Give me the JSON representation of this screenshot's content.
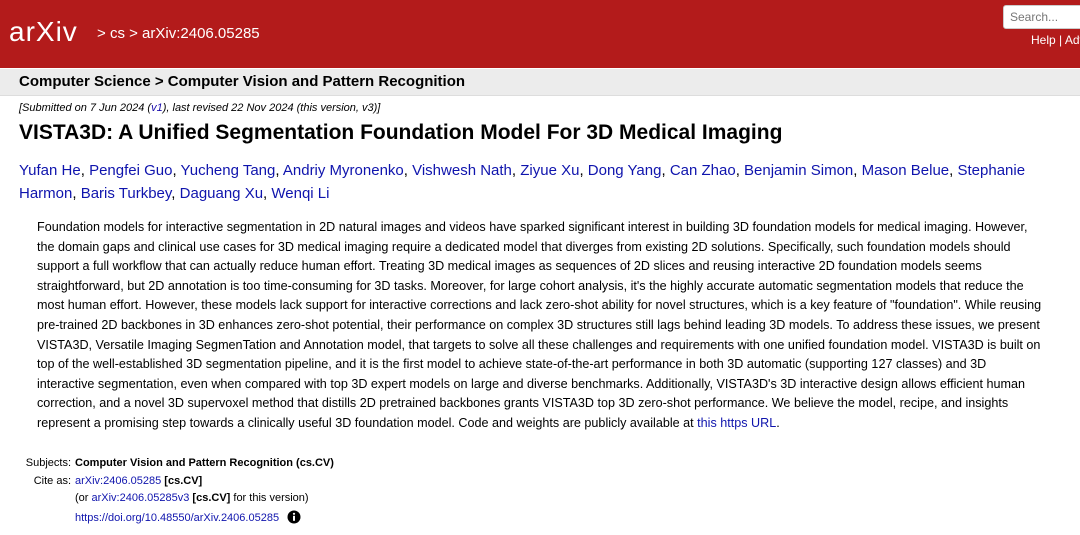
{
  "header": {
    "logo_text": "arXiv",
    "breadcrumb_sep": ">",
    "breadcrumb_cs": "cs",
    "breadcrumb_id": "arXiv:2406.05285",
    "search_placeholder": "Search...",
    "help_link": "Help",
    "link_sep": "|",
    "advanced_link": "Adv",
    "colors": {
      "bar": "#b31b1b",
      "link": "#0f14ad"
    }
  },
  "category": "Computer Science > Computer Vision and Pattern Recognition",
  "submission": {
    "submitted_prefix": "[Submitted on 7 Jun 2024 (",
    "v1_link": "v1",
    "submitted_suffix": "), last revised 22 Nov 2024 (this version, v3)]"
  },
  "title": "VISTA3D: A Unified Segmentation Foundation Model For 3D Medical Imaging",
  "authors": [
    "Yufan He",
    "Pengfei Guo",
    "Yucheng Tang",
    "Andriy Myronenko",
    "Vishwesh Nath",
    "Ziyue Xu",
    "Dong Yang",
    "Can Zhao",
    "Benjamin Simon",
    "Mason Belue",
    "Stephanie Harmon",
    "Baris Turkbey",
    "Daguang Xu",
    "Wenqi Li"
  ],
  "abstract": {
    "text": "Foundation models for interactive segmentation in 2D natural images and videos have sparked significant interest in building 3D foundation models for medical imaging. However, the domain gaps and clinical use cases for 3D medical imaging require a dedicated model that diverges from existing 2D solutions. Specifically, such foundation models should support a full workflow that can actually reduce human effort. Treating 3D medical images as sequences of 2D slices and reusing interactive 2D foundation models seems straightforward, but 2D annotation is too time-consuming for 3D tasks. Moreover, for large cohort analysis, it's the highly accurate automatic segmentation models that reduce the most human effort. However, these models lack support for interactive corrections and lack zero-shot ability for novel structures, which is a key feature of \"foundation\". While reusing pre-trained 2D backbones in 3D enhances zero-shot potential, their performance on complex 3D structures still lags behind leading 3D models. To address these issues, we present VISTA3D, Versatile Imaging SegmenTation and Annotation model, that targets to solve all these challenges and requirements with one unified foundation model. VISTA3D is built on top of the well-established 3D segmentation pipeline, and it is the first model to achieve state-of-the-art performance in both 3D automatic (supporting 127 classes) and 3D interactive segmentation, even when compared with top 3D expert models on large and diverse benchmarks. Additionally, VISTA3D's 3D interactive design allows efficient human correction, and a novel 3D supervoxel method that distills 2D pretrained backbones grants VISTA3D top 3D zero-shot performance. We believe the model, recipe, and insights represent a promising step towards a clinically useful 3D foundation model. Code and weights are publicly available at ",
    "link_text": "this https URL",
    "end": "."
  },
  "metadata": {
    "subjects_label": "Subjects:",
    "subjects_value": "Computer Vision and Pattern Recognition (cs.CV)",
    "cite_label": "Cite as:",
    "cite_id": "arXiv:2406.05285",
    "cite_cat": "[cs.CV]",
    "version_prefix": "(or ",
    "version_id": "arXiv:2406.05285v3",
    "version_cat": "[cs.CV]",
    "version_suffix": " for this version)",
    "doi": "https://doi.org/10.48550/arXiv.2406.05285",
    "info_icon": "info-circle-icon"
  }
}
